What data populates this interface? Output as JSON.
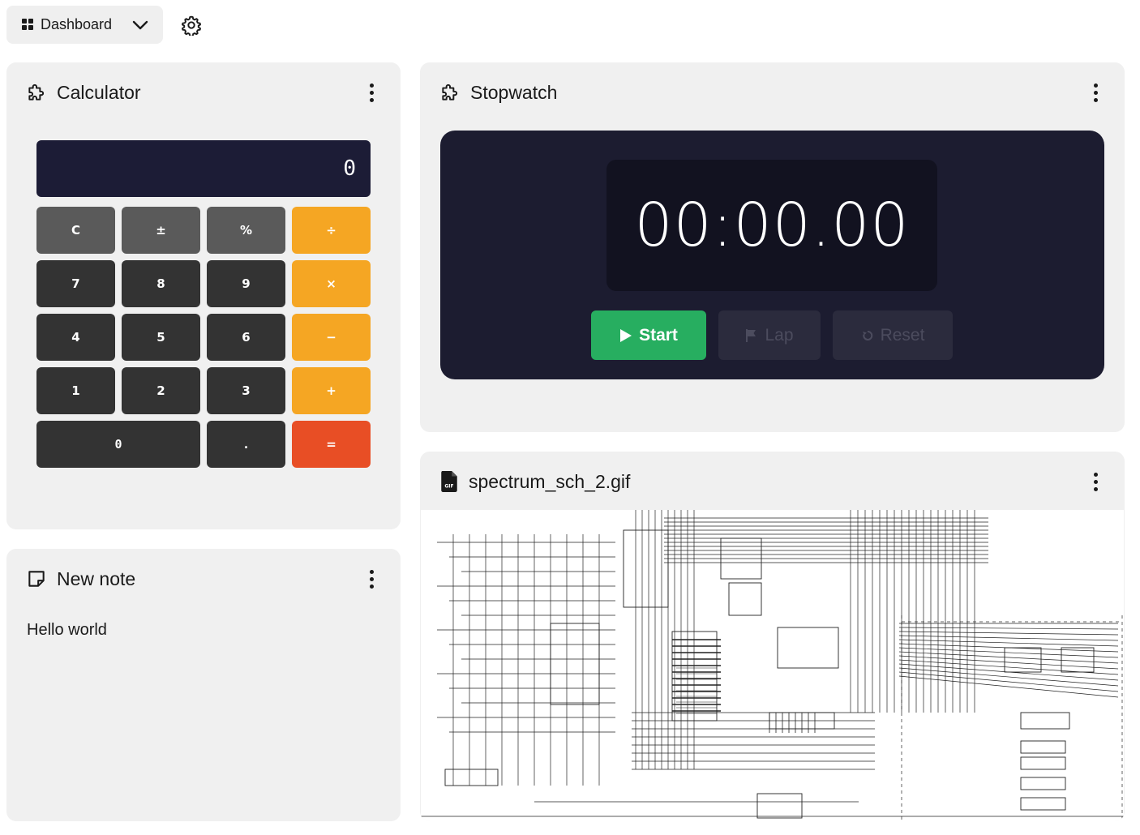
{
  "topbar": {
    "dashboard_label": "Dashboard"
  },
  "calculator": {
    "title": "Calculator",
    "display": "0",
    "keys": [
      {
        "label": "C",
        "kind": "fn"
      },
      {
        "label": "±",
        "kind": "fn"
      },
      {
        "label": "%",
        "kind": "fn"
      },
      {
        "label": "÷",
        "kind": "op"
      },
      {
        "label": "7",
        "kind": "num"
      },
      {
        "label": "8",
        "kind": "num"
      },
      {
        "label": "9",
        "kind": "num"
      },
      {
        "label": "×",
        "kind": "op"
      },
      {
        "label": "4",
        "kind": "num"
      },
      {
        "label": "5",
        "kind": "num"
      },
      {
        "label": "6",
        "kind": "num"
      },
      {
        "label": "−",
        "kind": "op"
      },
      {
        "label": "1",
        "kind": "num"
      },
      {
        "label": "2",
        "kind": "num"
      },
      {
        "label": "3",
        "kind": "num"
      },
      {
        "label": "+",
        "kind": "op"
      },
      {
        "label": "0",
        "kind": "num"
      },
      {
        "label": ".",
        "kind": "num"
      },
      {
        "label": "=",
        "kind": "eq"
      }
    ]
  },
  "stopwatch": {
    "title": "Stopwatch",
    "time": "00:00.00",
    "start_label": "Start",
    "lap_label": "Lap",
    "reset_label": "Reset"
  },
  "note": {
    "title": "New note",
    "content": "Hello world"
  },
  "image": {
    "filename": "spectrum_sch_2.gif",
    "file_icon_text": "GIF"
  },
  "icons": {
    "dashboard": "grid-icon",
    "settings": "gear-icon",
    "widget": "puzzle-icon",
    "note": "note-icon",
    "file": "gif-file-icon",
    "menu": "kebab-menu-icon",
    "start": "play-icon",
    "lap": "flag-icon",
    "reset": "reset-icon"
  },
  "colors": {
    "panel_bg": "#f0f0f0",
    "calc_display": "#1c1c36",
    "operator": "#f5a623",
    "equals": "#e84e25",
    "start_green": "#27ae60",
    "stopwatch_bg": "#1c1c30"
  }
}
